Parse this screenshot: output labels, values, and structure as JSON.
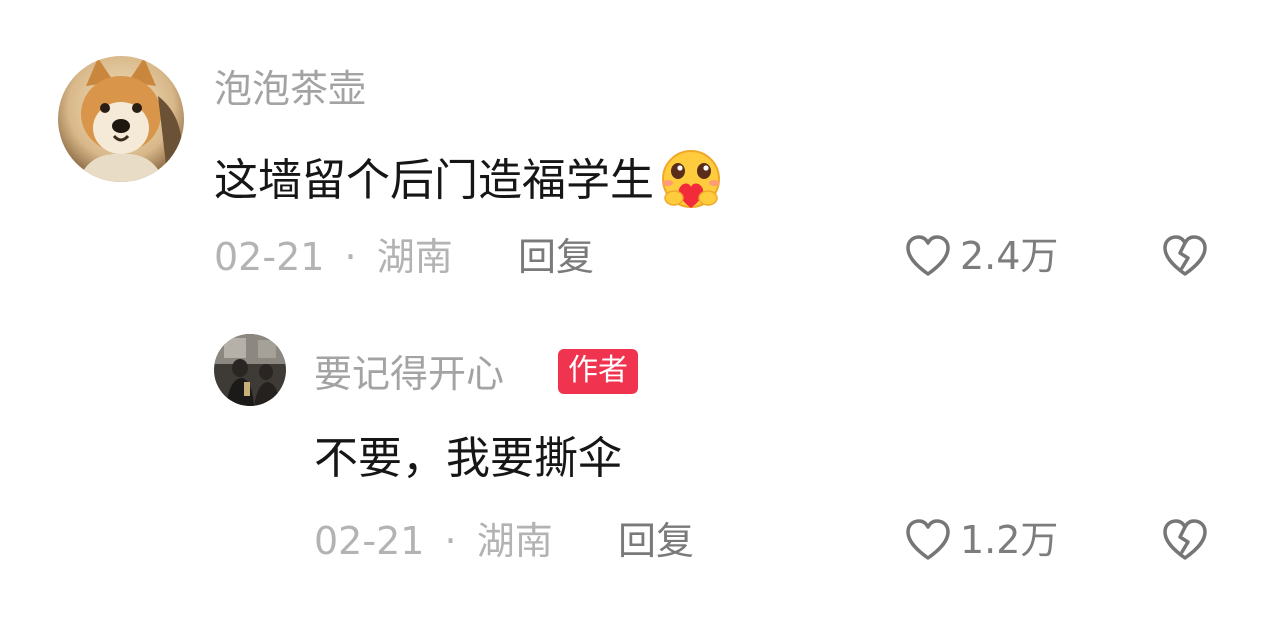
{
  "comments": [
    {
      "username": "泡泡茶壶",
      "text": "这墙留个后门造福学生",
      "emoji": "hug-heart-emoji",
      "date": "02-21",
      "separator": "·",
      "location": "湖南",
      "reply_label": "回复",
      "likes": "2.4万",
      "avatar": "shiba-dog-avatar"
    },
    {
      "username": "要记得开心",
      "badge": "作者",
      "text": "不要，我要撕伞",
      "date": "02-21",
      "separator": "·",
      "location": "湖南",
      "reply_label": "回复",
      "likes": "1.2万",
      "avatar": "dark-photo-avatar"
    }
  ],
  "colors": {
    "badge": "#f0334f",
    "username": "#a3a3a3",
    "text": "#161616",
    "meta": "#b3b3b3"
  },
  "icons": {
    "like": "heart-outline-icon",
    "dislike": "broken-heart-icon"
  }
}
